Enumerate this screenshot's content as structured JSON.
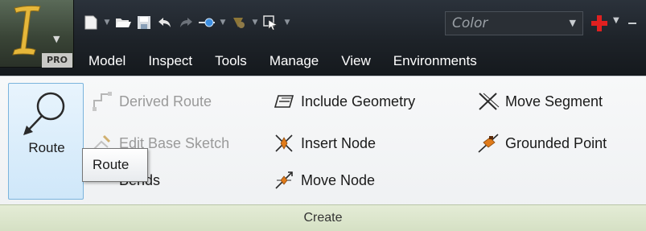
{
  "app": {
    "badge": "PRO",
    "logo_letter": "I"
  },
  "quick_access": {
    "color_dropdown_value": "Color",
    "icons": [
      "new-icon",
      "open-icon",
      "save-icon",
      "undo-icon",
      "redo-icon",
      "measure-icon",
      "appearance-icon",
      "select-icon"
    ]
  },
  "tabs": [
    "Model",
    "Inspect",
    "Tools",
    "Manage",
    "View",
    "Environments"
  ],
  "panel": {
    "title": "Create",
    "route_button_label": "Route",
    "commands": {
      "derived_route": "Derived Route",
      "edit_base_sketch": "Edit Base Sketch",
      "bends": "Bends",
      "include_geometry": "Include Geometry",
      "insert_node": "Insert Node",
      "move_node": "Move Node",
      "move_segment": "Move Segment",
      "grounded_point": "Grounded Point"
    }
  },
  "tooltip": {
    "text": "Route"
  },
  "colors": {
    "title_bar": "#1d2228",
    "route_highlight": "#cfe7f9",
    "panel_title_bar": "#d5e0c4",
    "accent_orange": "#e07b1a",
    "accent_red": "#e02020"
  }
}
